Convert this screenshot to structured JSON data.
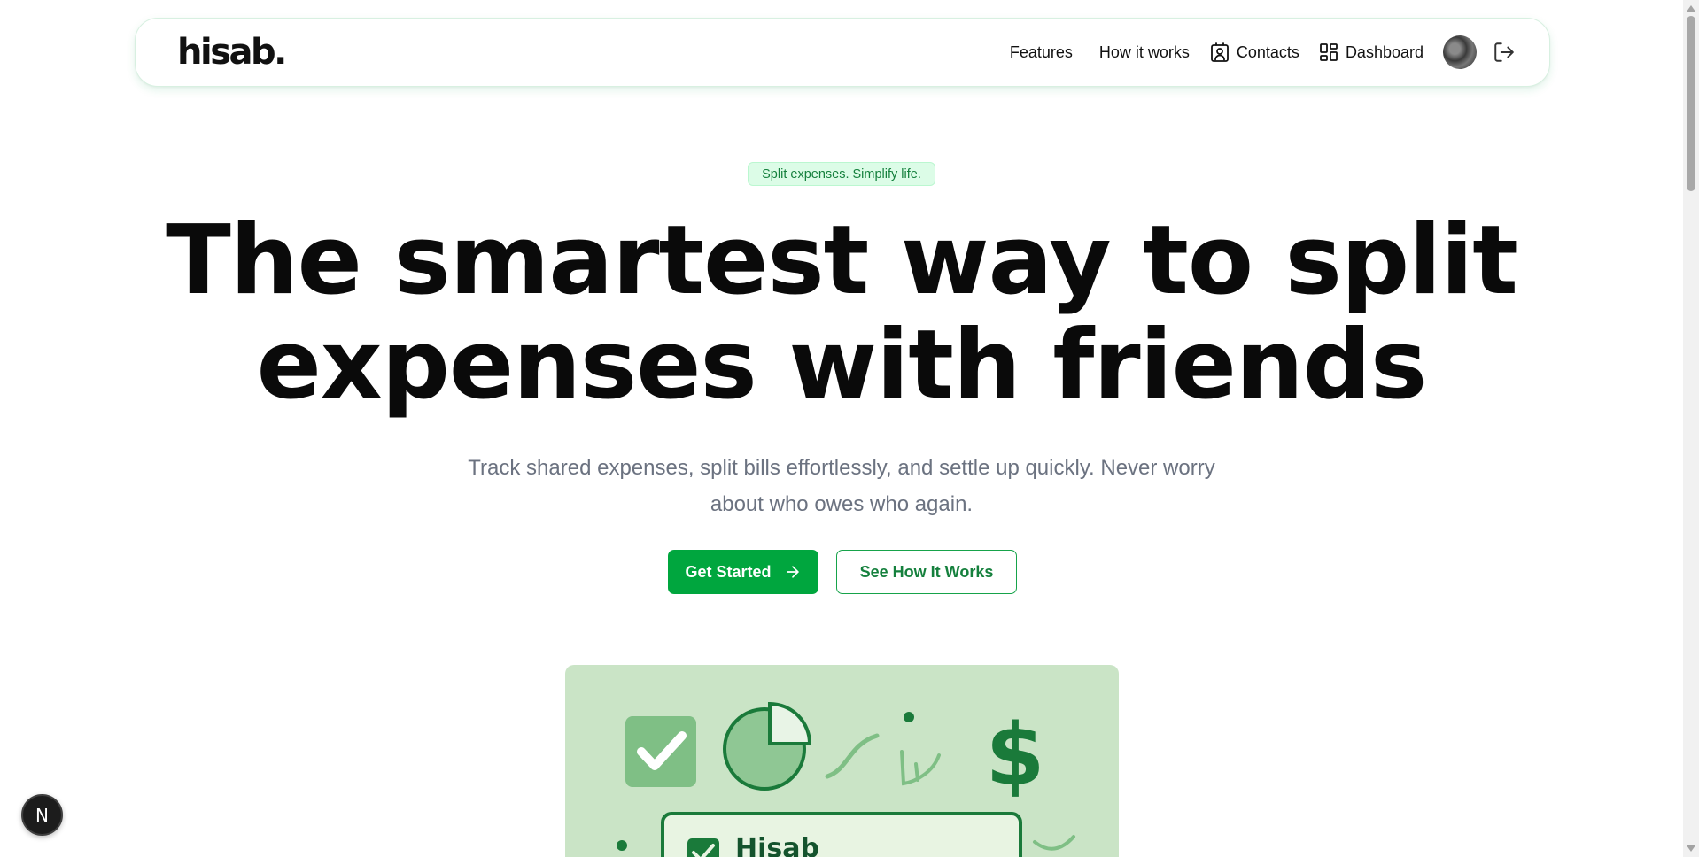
{
  "nav": {
    "logo": "hisab.",
    "links": {
      "features": "Features",
      "how_it_works": "How it works",
      "contacts": "Contacts",
      "dashboard": "Dashboard"
    },
    "icons": {
      "contacts": "contact-card-icon",
      "dashboard": "dashboard-grid-icon",
      "logout": "log-out-icon"
    }
  },
  "hero": {
    "badge": "Split expenses. Simplify life.",
    "title_line1": "The smartest way to split",
    "title_line2": "expenses with friends",
    "subtitle_line1": "Track shared expenses, split bills effortlessly, and settle up quickly. Never worry",
    "subtitle_line2": "about who owes who again.",
    "primary_button": "Get Started",
    "secondary_button": "See How It Works"
  },
  "illustration": {
    "card_title": "Hisab"
  },
  "dev_badge": "N",
  "colors": {
    "brand_green": "#00a63e",
    "dark_green": "#15803d",
    "badge_bg": "#dcfce7",
    "illustration_bg": "#cae4c6"
  }
}
